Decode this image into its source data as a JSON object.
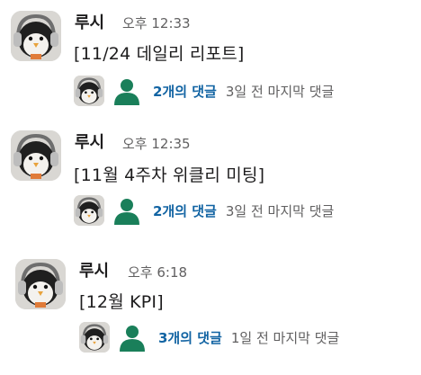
{
  "messages": [
    {
      "author": "루시",
      "time": "오후 12:33",
      "text": "[11/24 데일리 리포트]",
      "thread": {
        "replies": "2개의 댓글",
        "last_reply": "3일 전 마지막 댓글"
      }
    },
    {
      "author": "루시",
      "time": "오후 12:35",
      "text": "[11월 4주차 위클리 미팅]",
      "thread": {
        "replies": "2개의 댓글",
        "last_reply": "3일 전 마지막 댓글"
      }
    },
    {
      "author": "루시",
      "time": "오후 6:18",
      "text": "[12월 KPI]",
      "thread": {
        "replies": "3개의 댓글",
        "last_reply": "1일 전 마지막 댓글"
      }
    }
  ],
  "colors": {
    "link": "#1264a3",
    "muted": "#616061",
    "default_avatar": "#1a7f5a"
  },
  "icons": {
    "author_avatar": "penguin-headphones-avatar",
    "participant_avatar": "default-user-avatar"
  }
}
